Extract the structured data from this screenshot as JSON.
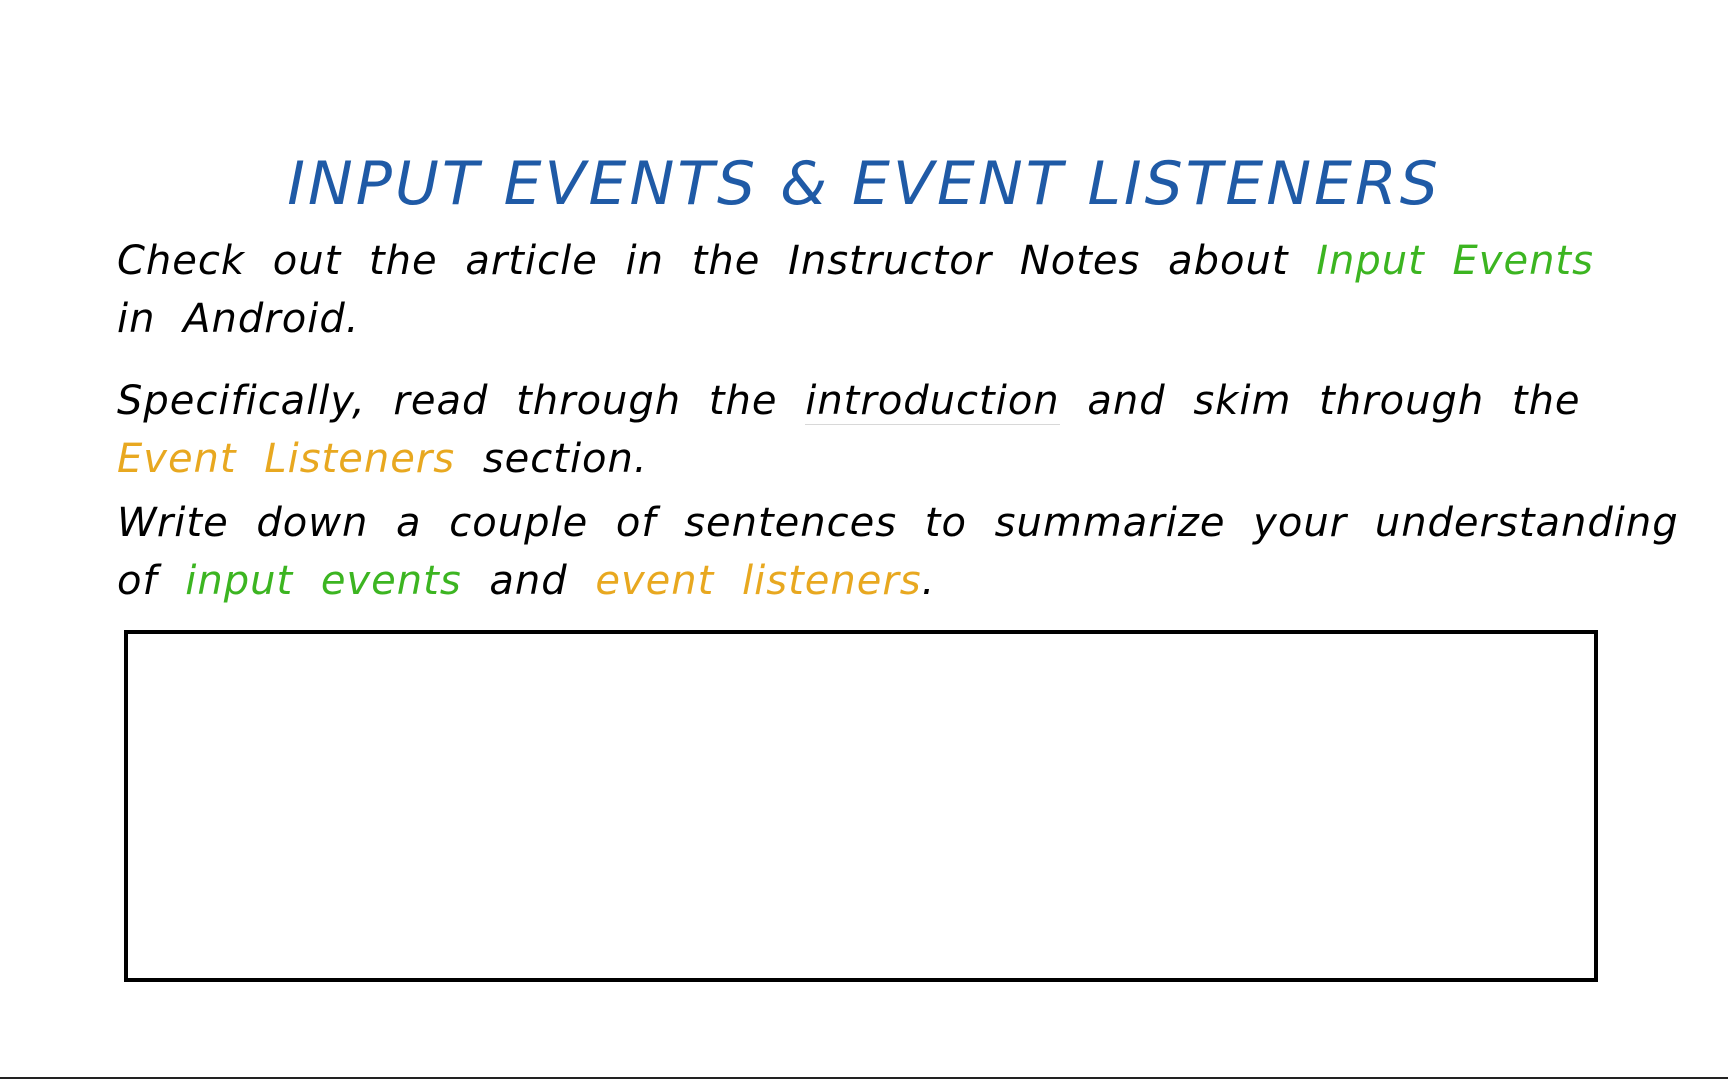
{
  "colors": {
    "title": "#1f5aa6",
    "body_text": "#000000",
    "green_highlight": "#3cb521",
    "orange_highlight": "#e8a820",
    "box_border": "#000000"
  },
  "title": "INPUT EVENTS & EVENT LISTENERS",
  "paragraph1": {
    "line1_text": "Check out the article in the Instructor Notes about",
    "line1_highlight": "Input Events",
    "line2_text": "in Android."
  },
  "paragraph2": {
    "line1_a": "Specifically, read through the",
    "line1_link": "introduction",
    "line1_b": "and skim through the",
    "line2_highlight": "Event Listeners",
    "line2_text": "section."
  },
  "paragraph3": {
    "line1_text": "Write down a couple of sentences to summarize your understanding",
    "line2_a": "of",
    "line2_highlight1": "input events",
    "line2_b": "and",
    "line2_highlight2": "event listeners",
    "line2_c": "."
  }
}
